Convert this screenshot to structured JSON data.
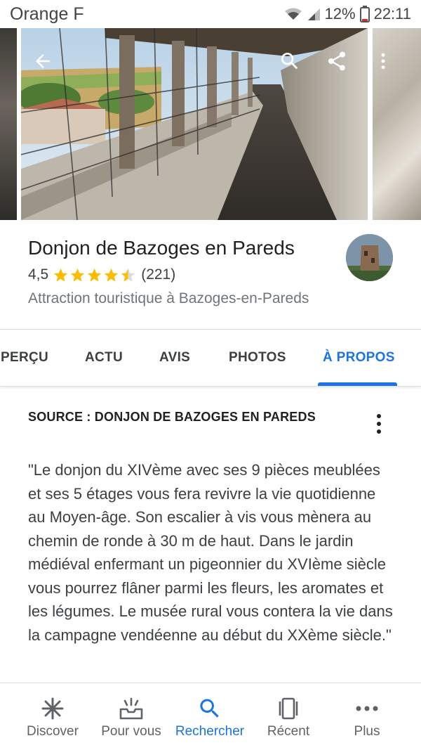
{
  "status_bar": {
    "carrier": "Orange F",
    "battery": "12%",
    "time": "22:11"
  },
  "hero": {
    "back_icon": "arrow-back-icon",
    "search_icon": "search-icon",
    "share_icon": "share-icon",
    "more_icon": "more-vert-icon"
  },
  "place": {
    "title": "Donjon de Bazoges en Pareds",
    "rating": "4,5",
    "stars": 4.5,
    "reviews": "(221)",
    "category": "Attraction touristique à Bazoges-en-Pareds"
  },
  "tabs": [
    {
      "label": "APERÇU"
    },
    {
      "label": "ACTU"
    },
    {
      "label": "AVIS"
    },
    {
      "label": "PHOTOS"
    },
    {
      "label": "À PROPOS"
    }
  ],
  "active_tab": "À PROPOS",
  "about": {
    "source": "SOURCE : DONJON DE BAZOGES EN PAREDS",
    "description": "\"Le donjon du XIVème avec ses 9 pièces meublées et ses 5 étages vous fera revivre la vie quotidienne au Moyen-âge. Son escalier à vis vous mènera au chemin de ronde à 30 m de haut. Dans le jardin médiéval enfermant un pigeonnier du XVIème siècle vous pourrez flâner parmi les fleurs, les aromates et les légumes. Le musée rural vous contera la vie dans la campagne vendéenne au début du XXème siècle.\""
  },
  "bottom_nav": [
    {
      "label": "Discover",
      "icon": "asterisk-icon"
    },
    {
      "label": "Pour vous",
      "icon": "inbox-sparkle-icon"
    },
    {
      "label": "Rechercher",
      "icon": "search-icon"
    },
    {
      "label": "Récent",
      "icon": "cards-icon"
    },
    {
      "label": "Plus",
      "icon": "more-horiz-icon"
    }
  ],
  "colors": {
    "accent": "#1a73e8",
    "star": "#fbbc04",
    "text": "#202124",
    "secondary": "#70757a"
  }
}
